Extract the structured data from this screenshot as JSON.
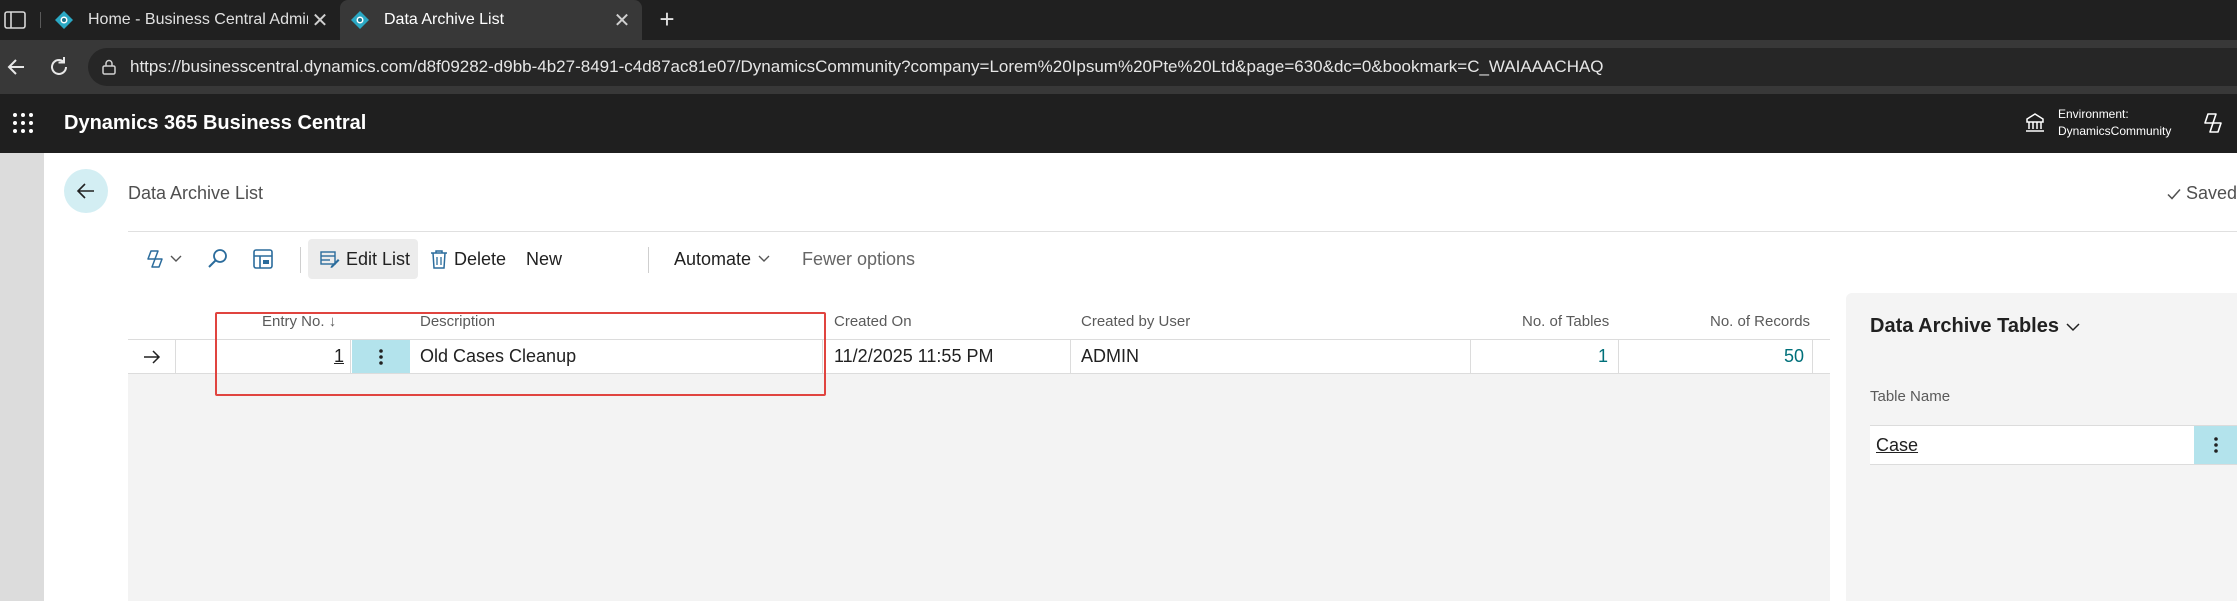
{
  "browser": {
    "tabs": [
      {
        "title": "Home - Business Central Admin C",
        "active": false
      },
      {
        "title": "Data Archive List",
        "active": true
      }
    ],
    "url": "https://businesscentral.dynamics.com/d8f09282-d9bb-4b27-8491-c4d87ac81e07/DynamicsCommunity?company=Lorem%20Ipsum%20Pte%20Ltd&page=630&dc=0&bookmark=C_WAIAAACHAQ"
  },
  "app": {
    "name": "Dynamics 365 Business Central",
    "environment_label": "Environment:",
    "environment_name": "DynamicsCommunity"
  },
  "page": {
    "title": "Data Archive List",
    "status": "Saved"
  },
  "actions": {
    "edit_list": "Edit List",
    "delete": "Delete",
    "new": "New",
    "automate": "Automate",
    "fewer_options": "Fewer options"
  },
  "list": {
    "columns": {
      "entry_no": "Entry No.",
      "description": "Description",
      "created_on": "Created On",
      "created_by": "Created by User",
      "no_tables": "No. of Tables",
      "no_records": "No. of Records"
    },
    "rows": [
      {
        "entry_no": "1",
        "description": "Old Cases Cleanup",
        "created_on": "11/2/2025 11:55 PM",
        "created_by": "ADMIN",
        "no_tables": "1",
        "no_records": "50"
      }
    ]
  },
  "factbox": {
    "title": "Data Archive Tables",
    "column": "Table Name",
    "rows": [
      "Case"
    ]
  },
  "colors": {
    "accent": "#00707a",
    "selection": "#b3e3ec",
    "highlight_border": "#e0443f",
    "appbar": "#1f1f1f"
  }
}
